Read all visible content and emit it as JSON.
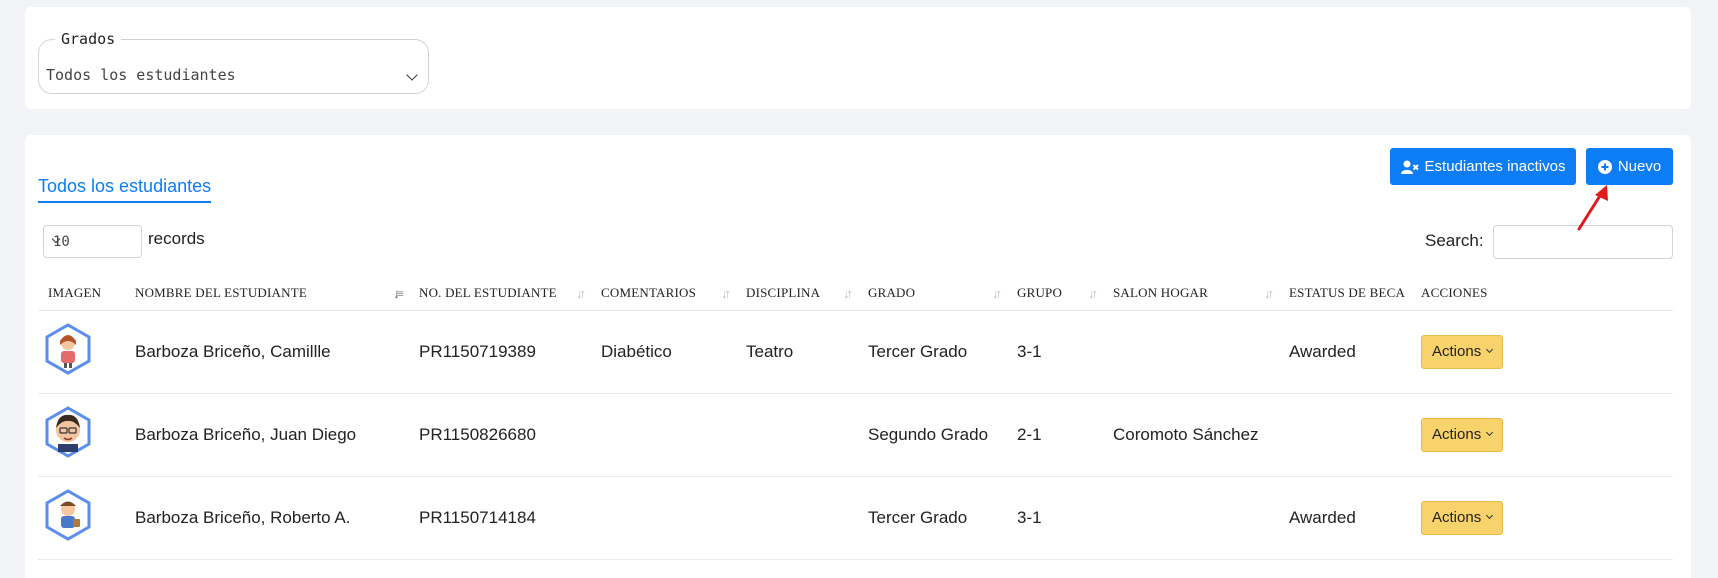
{
  "filter": {
    "legend": "Grados",
    "selected": "Todos los estudiantes"
  },
  "toolbar": {
    "inactive_label": "Estudiantes inactivos",
    "new_label": "Nuevo"
  },
  "tabs": [
    {
      "label": "Todos los estudiantes",
      "active": true
    }
  ],
  "table_controls": {
    "page_length": "10",
    "records_label": "records",
    "search_label": "Search:",
    "search_value": ""
  },
  "columns": [
    "IMAGEN",
    "NOMBRE DEL ESTUDIANTE",
    "NO. DEL ESTUDIANTE",
    "COMENTARIOS",
    "DISCIPLINA",
    "GRADO",
    "GRUPO",
    "SALON HOGAR",
    "ESTATUS DE BECA",
    "ACCIONES"
  ],
  "rows": [
    {
      "avatar": "girl-student-avatar-icon",
      "name": "Barboza Briceño, Camillle",
      "number": "PR1150719389",
      "comments": "Diabético",
      "discipline": "Teatro",
      "grade": "Tercer Grado",
      "group": "3-1",
      "homeroom": "",
      "scholarship": "Awarded",
      "actions": "Actions"
    },
    {
      "avatar": "boy-student-avatar-icon",
      "name": "Barboza Briceño, Juan Diego",
      "number": "PR1150826680",
      "comments": "",
      "discipline": "",
      "grade": "Segundo Grado",
      "group": "2-1",
      "homeroom": "Coromoto Sánchez",
      "scholarship": "",
      "actions": "Actions"
    },
    {
      "avatar": "boy-student-avatar-icon",
      "name": "Barboza Briceño, Roberto A.",
      "number": "PR1150714184",
      "comments": "",
      "discipline": "",
      "grade": "Tercer Grado",
      "group": "3-1",
      "homeroom": "",
      "scholarship": "Awarded",
      "actions": "Actions"
    }
  ],
  "colors": {
    "primary": "#0d7df5",
    "warning": "#f8d26a",
    "background": "#f2f3f7",
    "annotation": "#e01b1b"
  }
}
